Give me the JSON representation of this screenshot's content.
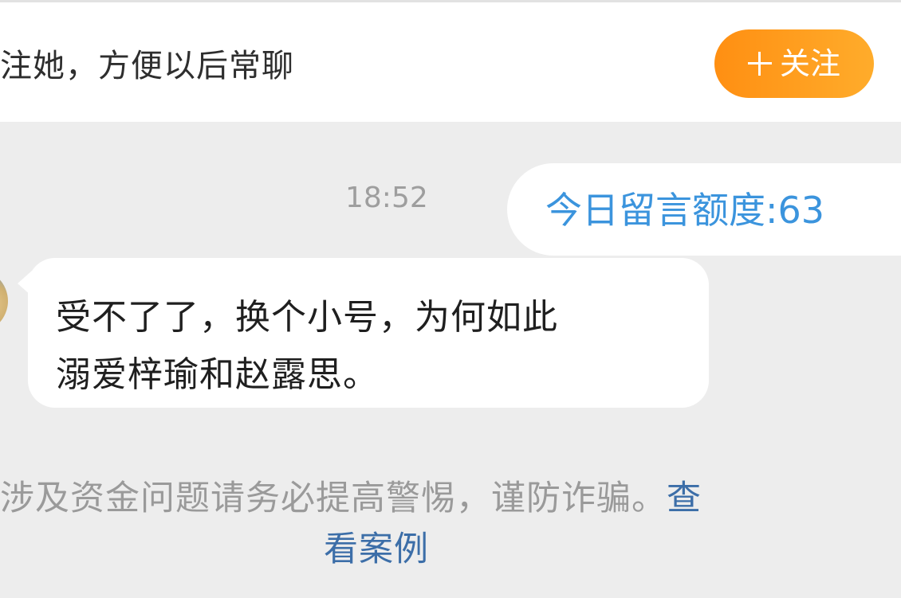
{
  "follow_bar": {
    "prompt_text": "注她，方便以后常聊",
    "follow_button": {
      "icon": "plus-icon",
      "label": "关注"
    }
  },
  "conversation": {
    "timestamp": "18:52",
    "quota_message": "今日留言额度:63",
    "incoming_message": {
      "avatar": "avatar",
      "line1": "受不了了，换个小号，为何如此",
      "line2": "溺爱梓瑜和赵露思。"
    }
  },
  "safety_notice": {
    "text": "涉及资金问题请务必提高警惕，谨防诈骗。",
    "link_part1": "查",
    "link_part2": "看案例"
  },
  "colors": {
    "background": "#ededed",
    "follow_button_start": "#ff8f12",
    "follow_button_end": "#ffac2b",
    "quota_text": "#3b94dd",
    "link": "#3c6ea8"
  }
}
